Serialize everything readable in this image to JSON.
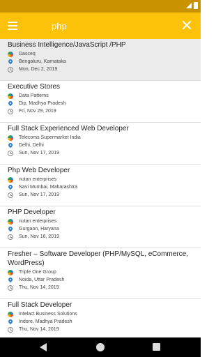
{
  "status_bar": {
    "time": ""
  },
  "search": {
    "value": "php",
    "placeholder": ""
  },
  "colors": {
    "app_bar": "#fcc20a",
    "status_bar": "#c99300",
    "selected_row": "#ebebeb"
  },
  "icons": {
    "menu": "menu-icon",
    "close": "close-icon",
    "company": "company-icon",
    "location": "location-pin-icon",
    "date": "clock-icon"
  },
  "jobs": [
    {
      "title": "Business Intelligence/JavaScript /PHP",
      "company": "Dasceq",
      "location": "Bengaluru, Karnataka",
      "date": "Mon, Dec 2, 2019"
    },
    {
      "title": "Executive Stores",
      "company": "Data Patterns",
      "location": "Dip, Madhya Pradesh",
      "date": "Fri, Nov 29, 2019"
    },
    {
      "title": "Full Stack Experienced Web Developer",
      "company": "Telecoms Supermarket India",
      "location": "Delhi, Delhi",
      "date": "Sun, Nov 17, 2019"
    },
    {
      "title": "Php Web Developer",
      "company": "nutan enterprises",
      "location": "Navi Mumbai, Maharashtra",
      "date": "Sun, Nov 17, 2019"
    },
    {
      "title": "PHP Developer",
      "company": "nutan enterprises",
      "location": "Gurgaon, Haryana",
      "date": "Sun, Nov 16, 2019"
    },
    {
      "title": "Fresher – Software Developer (PHP/MySQL, eCommerce, WordPress)",
      "company": "Triple One Group",
      "location": "Noida, Uttar Pradesh",
      "date": "Thu, Nov 14, 2019"
    },
    {
      "title": "Full Stack Developer",
      "company": "Intelact Business Solutions",
      "location": "Indore, Madhya Pradesh",
      "date": "Thu, Nov 14, 2019"
    }
  ]
}
